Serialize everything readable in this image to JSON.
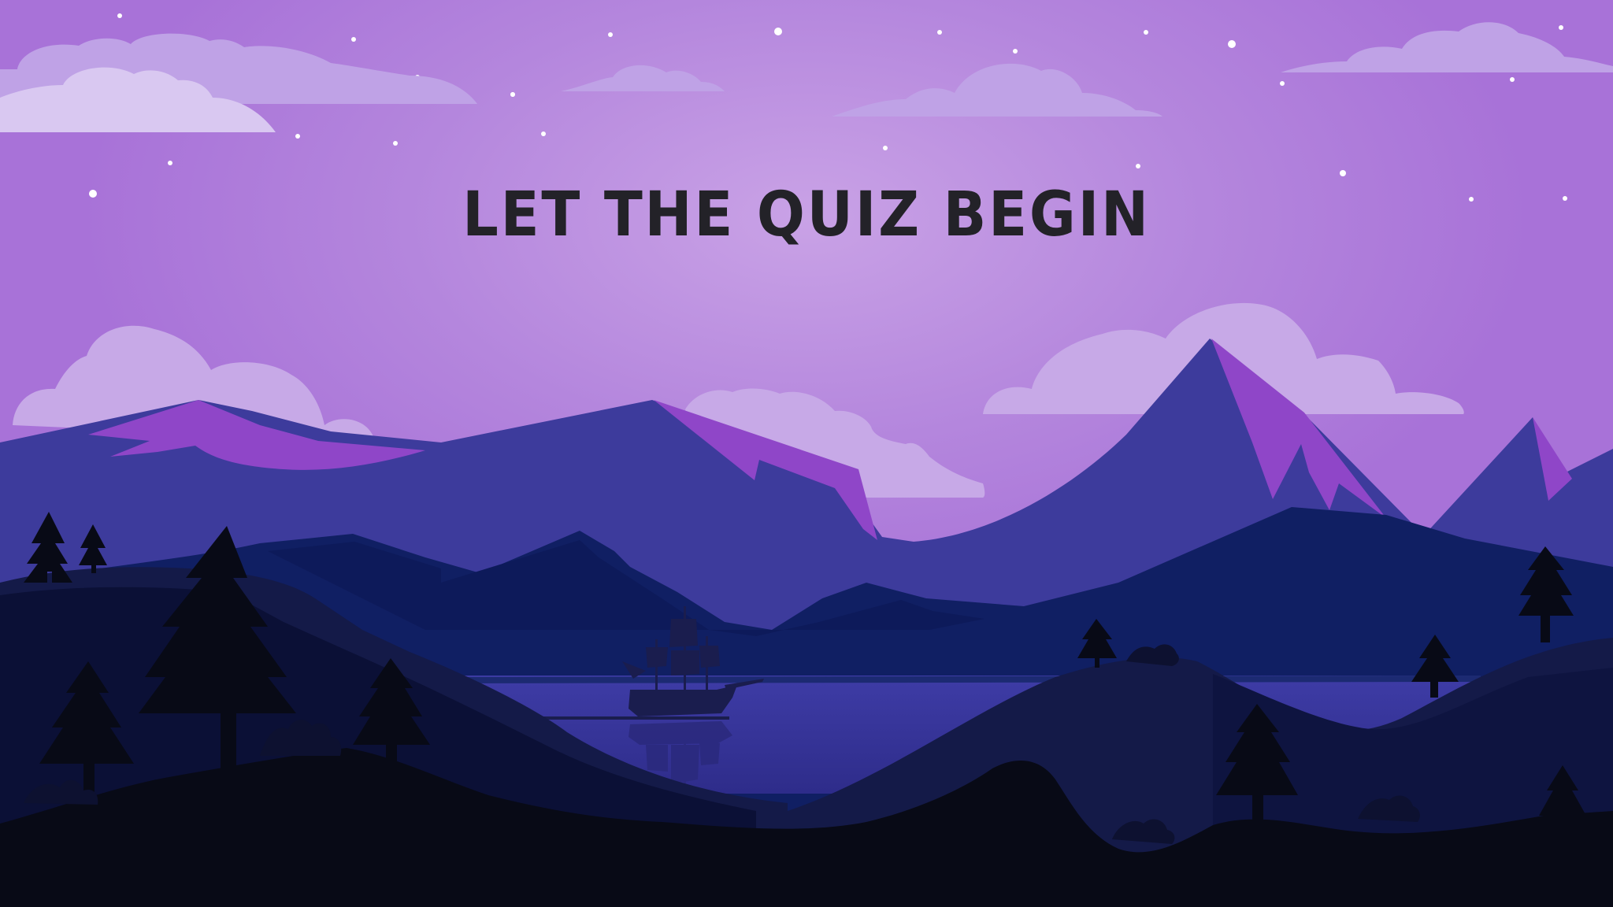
{
  "screen": {
    "title": "LET THE QUIZ BEGIN"
  },
  "colors": {
    "sky_top": "#a872d8",
    "sky_glow": "#c79ee4",
    "cloud": "#c6a8e6",
    "cloud_light": "#d8c6f0",
    "mountain_far": "#3d3b9c",
    "snow_cap": "#8f46c8",
    "mountain_mid": "#0f1e62",
    "lake": "#3b3aa0",
    "hills_dark": "#0a0f2e",
    "foreground": "#080a16",
    "title_text": "#232228",
    "star": "#ffffff"
  },
  "icons": [
    "star-icon",
    "tree-icon",
    "ship-icon",
    "cloud-icon"
  ]
}
